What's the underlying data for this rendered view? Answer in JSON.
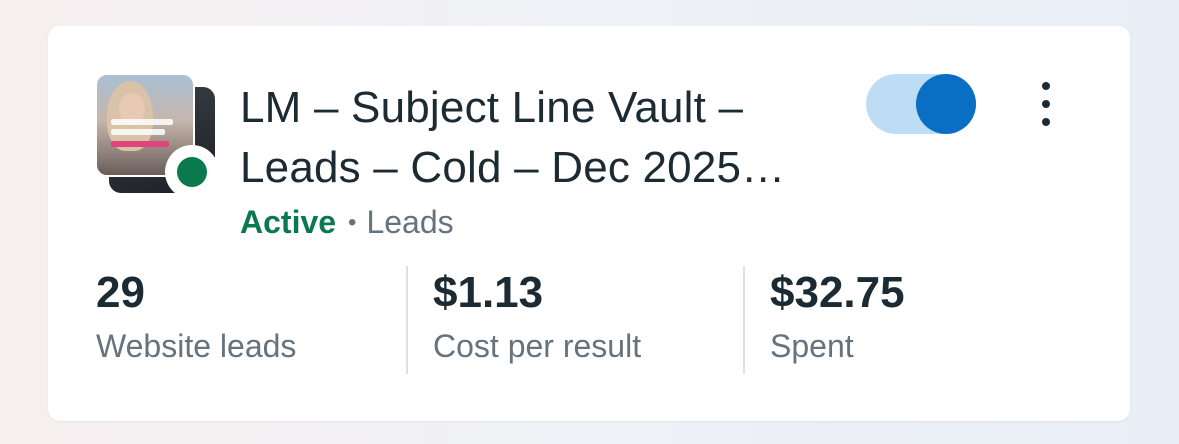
{
  "campaign": {
    "title_line1": "LM – Subject Line Vault –",
    "title_line2": "Leads – Cold – Dec 2025…",
    "status": "Active",
    "separator": "•",
    "objective": "Leads",
    "thumbnail_icon": "ad-creative-thumbnail",
    "status_color": "#0a7a4e",
    "toggle_on": true,
    "toggle_color": "#0a6fc2"
  },
  "metrics": [
    {
      "value": "29",
      "label": "Website leads"
    },
    {
      "value": "$1.13",
      "label": "Cost per result"
    },
    {
      "value": "$32.75",
      "label": "Spent"
    }
  ]
}
